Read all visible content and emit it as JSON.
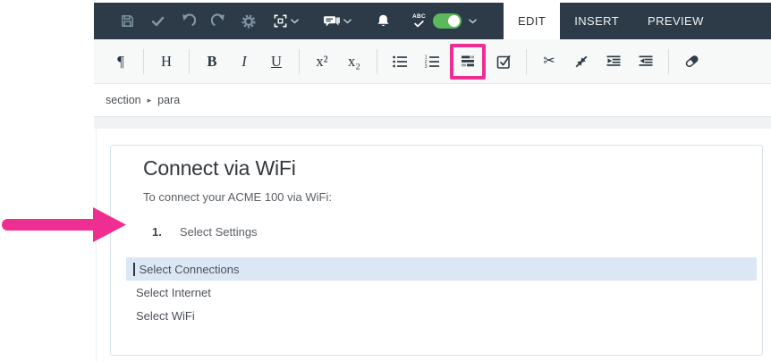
{
  "topbar": {
    "icon_buttons": [
      {
        "name": "save",
        "icon": "floppy-icon"
      },
      {
        "name": "approve",
        "icon": "check-icon"
      },
      {
        "name": "undo",
        "icon": "undo-arrow-icon"
      },
      {
        "name": "redo",
        "icon": "redo-arrow-icon"
      },
      {
        "name": "settings",
        "icon": "gear-icon"
      },
      {
        "name": "fullscreen",
        "icon": "fullscreen-icon",
        "has_dropdown": true
      },
      {
        "name": "comments",
        "icon": "chat-bubbles-icon",
        "has_dropdown": true
      },
      {
        "name": "notifications",
        "icon": "bell-icon"
      },
      {
        "name": "spellcheck",
        "icon": "abc-check-icon",
        "toggle_on": true,
        "has_dropdown": true
      }
    ],
    "spellcheck_abc": "ABC",
    "tabs": [
      {
        "label": "EDIT",
        "active": true
      },
      {
        "label": "INSERT",
        "active": false
      },
      {
        "label": "PREVIEW",
        "active": false
      }
    ]
  },
  "format_toolbar": {
    "buttons": [
      {
        "name": "paragraph",
        "label": "¶"
      },
      {
        "name": "heading",
        "label": "H"
      },
      {
        "name": "bold",
        "label": "B"
      },
      {
        "name": "italic",
        "label": "I"
      },
      {
        "name": "underline",
        "label": "U"
      },
      {
        "name": "superscript",
        "label": "x²"
      },
      {
        "name": "subscript",
        "label": "x₂"
      },
      {
        "name": "bullet-list",
        "icon": "bullet-list-icon"
      },
      {
        "name": "ordered-list",
        "icon": "ordered-list-icon"
      },
      {
        "name": "procedure",
        "icon": "procedure-icon",
        "highlighted": true
      },
      {
        "name": "checklist",
        "icon": "checkbox-icon"
      },
      {
        "name": "cut",
        "icon": "scissors-icon"
      },
      {
        "name": "merge",
        "icon": "merge-arrows-icon"
      },
      {
        "name": "indent-block",
        "icon": "indent-block-icon"
      },
      {
        "name": "outdent-block",
        "icon": "outdent-block-icon"
      },
      {
        "name": "eraser",
        "icon": "eraser-icon"
      }
    ]
  },
  "breadcrumb": {
    "separator": "▸",
    "items": [
      "section",
      "para"
    ]
  },
  "document": {
    "title": "Connect via WiFi",
    "intro": "To connect your ACME 100 via WiFi:",
    "list_item": {
      "number": "1.",
      "text": "Select Settings"
    },
    "lines": [
      {
        "text": "Select Connections",
        "highlighted": true,
        "has_cursor": true
      },
      {
        "text": "Select Internet",
        "highlighted": false
      },
      {
        "text": "Select WiFi",
        "highlighted": false
      }
    ]
  },
  "colors": {
    "topbar_bg": "#2c3b47",
    "accent_pink": "#ee2e90",
    "toggle_green": "#5cb85c",
    "highlight_row_bg": "#dce7f6",
    "panel_border": "#d7e1ee"
  }
}
